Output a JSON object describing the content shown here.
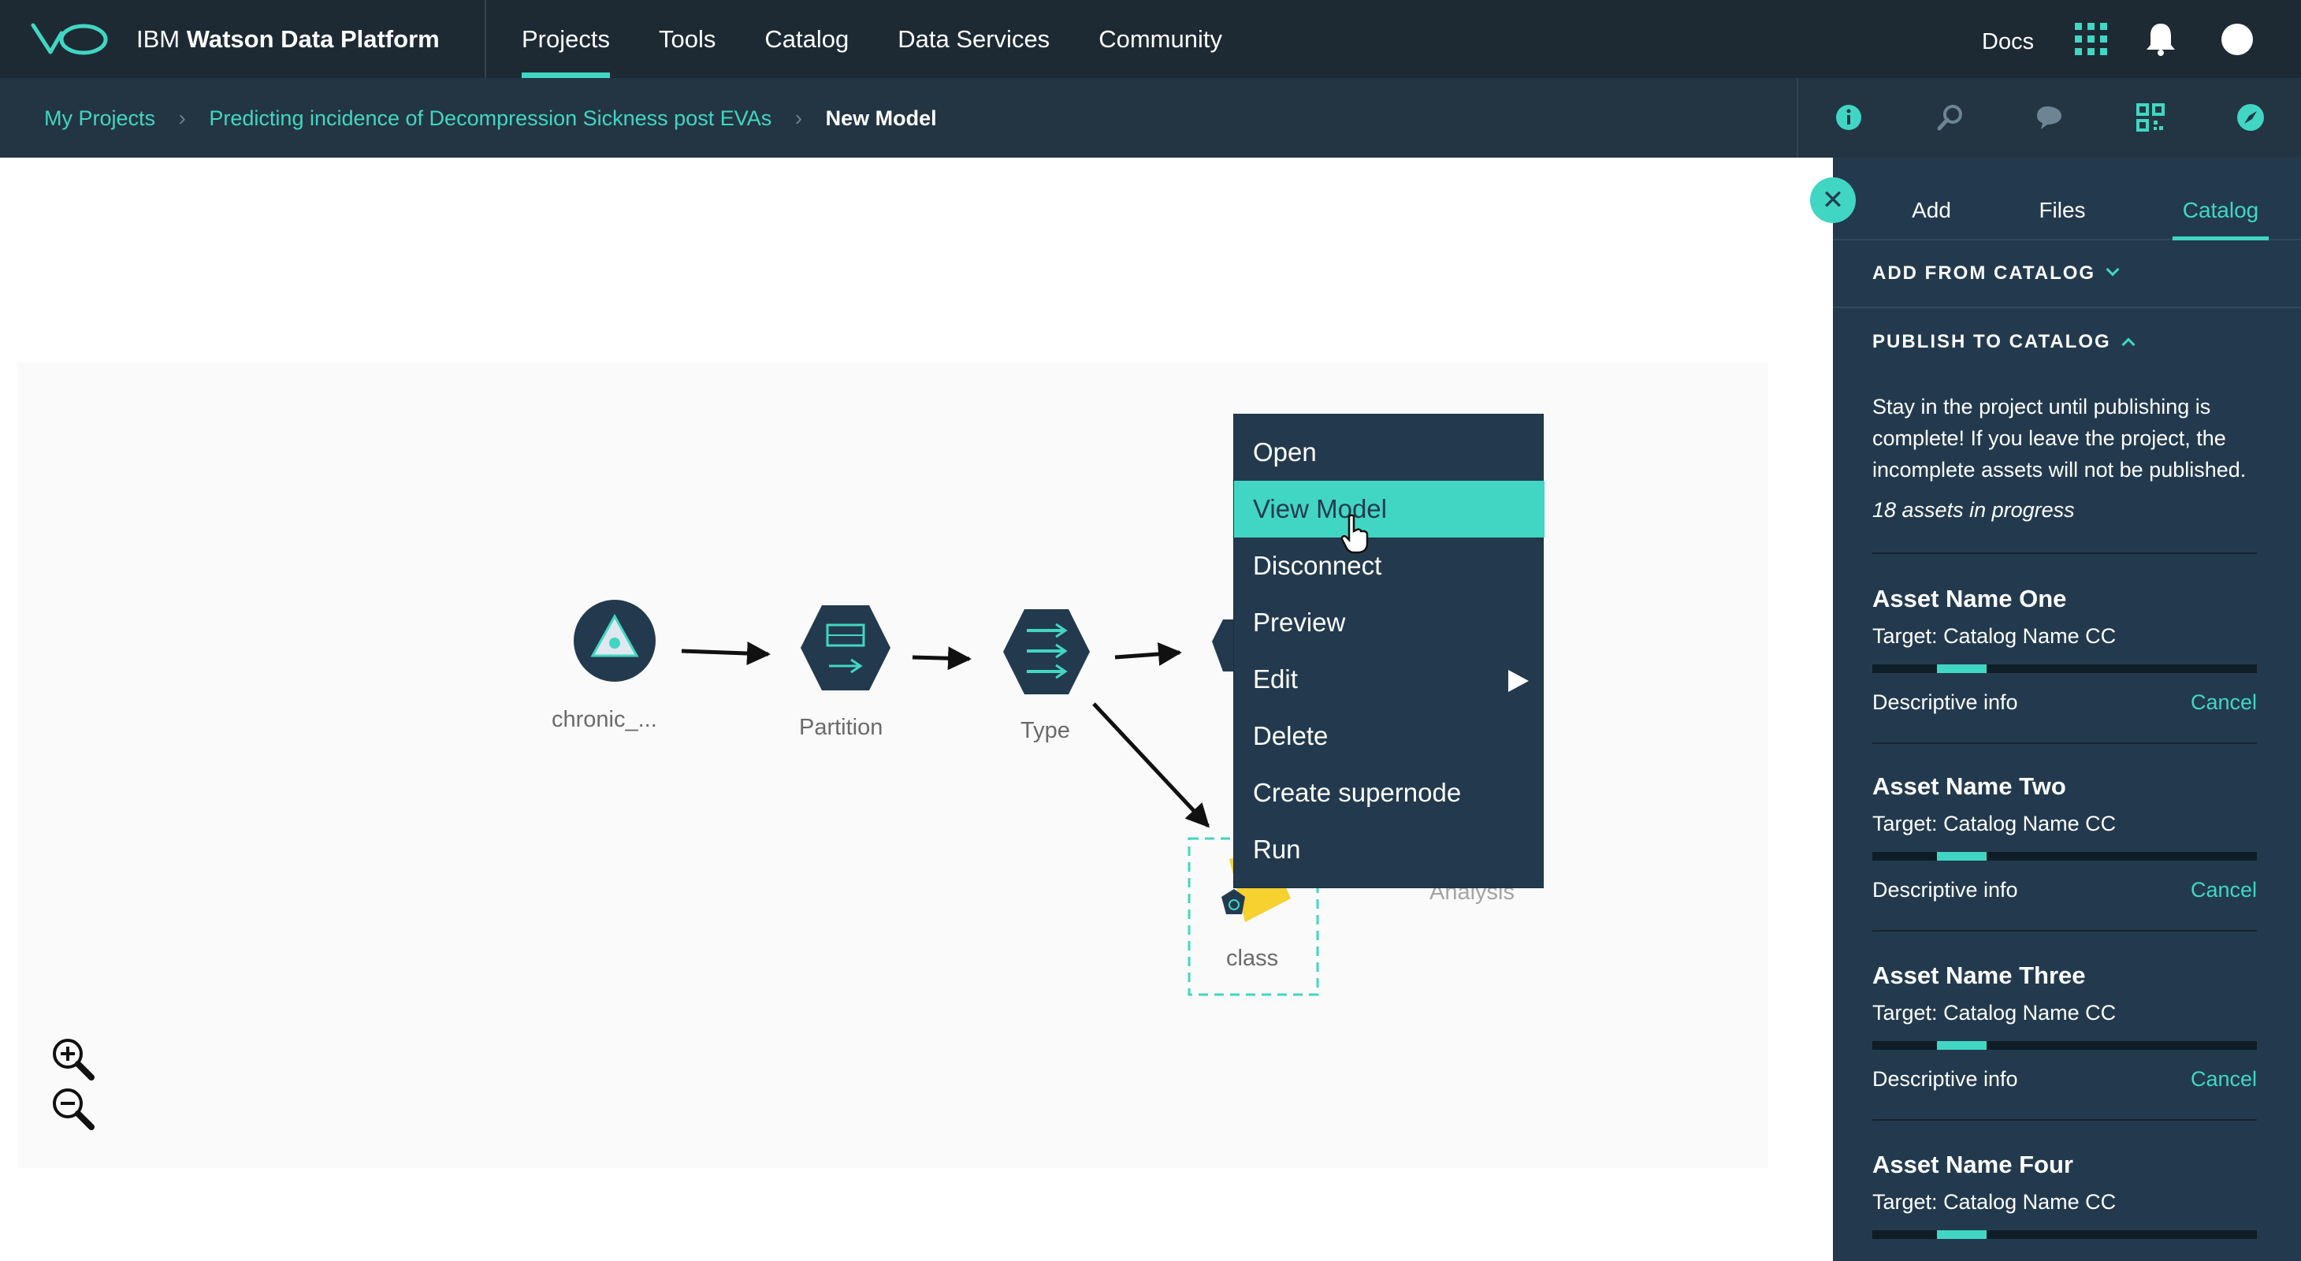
{
  "topbar": {
    "brand_prefix": "IBM",
    "brand_name": "Watson Data Platform",
    "nav": [
      "Projects",
      "Tools",
      "Catalog",
      "Data Services",
      "Community"
    ],
    "active_nav": "Projects",
    "docs_label": "Docs"
  },
  "breadcrumb": {
    "items": [
      "My Projects",
      "Predicting incidence of Decompression Sickness post EVAs"
    ],
    "current": "New Model"
  },
  "canvas": {
    "nodes": [
      "chronic_...",
      "Partition",
      "Type",
      "class",
      "Analysis"
    ]
  },
  "context_menu": {
    "items": [
      "Open",
      "View Model",
      "Disconnect",
      "Preview",
      "Edit",
      "Delete",
      "Create supernode",
      "Run"
    ],
    "highlighted": "View Model"
  },
  "panel": {
    "tabs": [
      "Add",
      "Files",
      "Catalog"
    ],
    "active_tab": "Catalog",
    "add_from_catalog": "ADD FROM CATALOG",
    "publish_to_catalog": "PUBLISH TO CATALOG",
    "notice": "Stay in the project until publishing is complete! If you leave the project, the incomplete assets will not be published.",
    "progress_note": "18 assets in progress",
    "target_label": "Target:",
    "assets": [
      {
        "name": "Asset Name One",
        "target": "Catalog Name CC",
        "progress": 0.13,
        "info": "Descriptive info",
        "cancel": "Cancel"
      },
      {
        "name": "Asset Name Two",
        "target": "Catalog Name CC",
        "progress": 0.13,
        "info": "Descriptive info",
        "cancel": "Cancel"
      },
      {
        "name": "Asset Name Three",
        "target": "Catalog Name CC",
        "progress": 0.13,
        "info": "Descriptive info",
        "cancel": "Cancel"
      },
      {
        "name": "Asset Name Four",
        "target": "Catalog Name CC",
        "progress": 0.13
      }
    ]
  },
  "colors": {
    "accent": "#41d6c3",
    "topbar": "#1d2a34",
    "subbar": "#233543",
    "panel": "#233a4e"
  },
  "icons": [
    "logo-icon",
    "apps-grid-icon",
    "notification-bell-icon",
    "user-avatar",
    "info-icon",
    "search-icon",
    "comments-icon",
    "qr-icon",
    "compass-icon",
    "close-icon",
    "zoom-in-icon",
    "zoom-out-icon"
  ]
}
